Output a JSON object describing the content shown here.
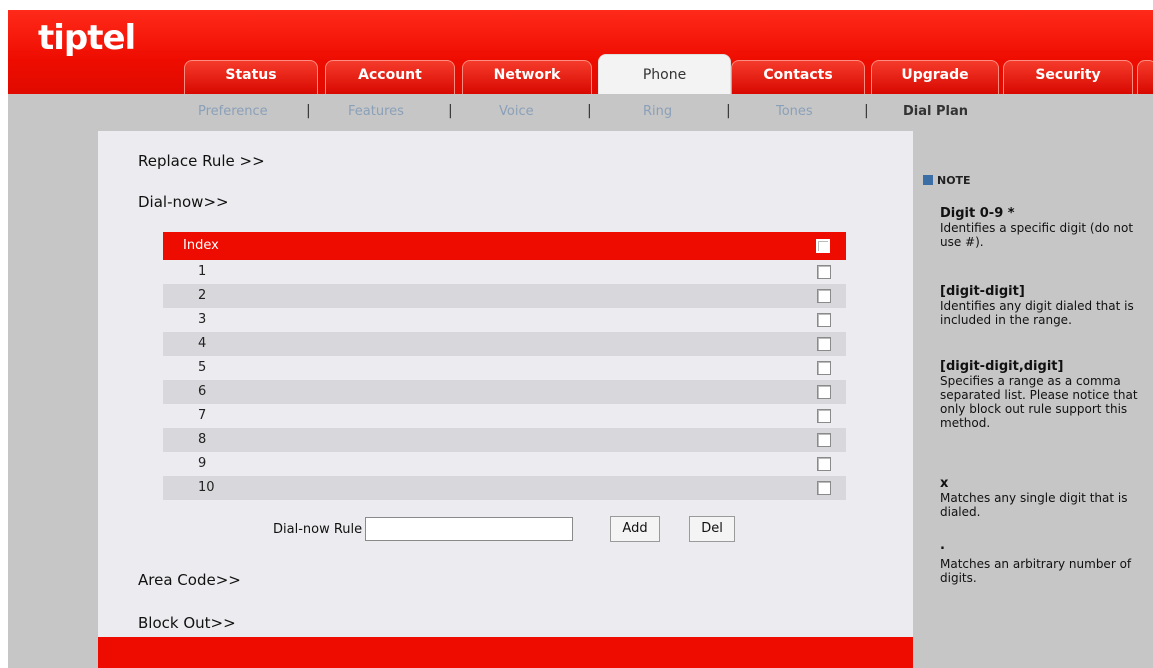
{
  "app": {
    "logo": "tiptel"
  },
  "tabs": [
    {
      "label": "Status"
    },
    {
      "label": "Account"
    },
    {
      "label": "Network"
    },
    {
      "label": "Phone"
    },
    {
      "label": "Contacts"
    },
    {
      "label": "Upgrade"
    },
    {
      "label": "Security"
    }
  ],
  "subnav": [
    {
      "label": "Preference"
    },
    {
      "label": "Features"
    },
    {
      "label": "Voice"
    },
    {
      "label": "Ring"
    },
    {
      "label": "Tones"
    },
    {
      "label": "Dial Plan"
    }
  ],
  "subnav_separator": "|",
  "sections": {
    "replace_rule": "Replace Rule >>",
    "dial_now": "Dial-now>>",
    "area_code": "Area Code>>",
    "block_out": "Block Out>>"
  },
  "table": {
    "header": "Index",
    "rows": [
      "1",
      "2",
      "3",
      "4",
      "5",
      "6",
      "7",
      "8",
      "9",
      "10"
    ]
  },
  "form": {
    "rule_label": "Dial-now Rule",
    "rule_value": "",
    "add_label": "Add",
    "del_label": "Del"
  },
  "note": {
    "heading": "NOTE",
    "items": [
      {
        "title": "Digit 0-9 *",
        "text": "Identifies a specific digit (do not use #)."
      },
      {
        "title": "[digit-digit]",
        "text": "Identifies any digit dialed that is included in the range."
      },
      {
        "title": "[digit-digit,digit]",
        "text": "Specifies a range as a comma separated list. Please notice that only block out rule support this method."
      },
      {
        "title": "x",
        "text": "Matches any single digit that is dialed."
      },
      {
        "title": ".",
        "text": "Matches an arbitrary number of digits."
      }
    ]
  },
  "colors": {
    "accent": "#ee0c00",
    "panel": "#c6c6c6",
    "main_bg": "#ececf0"
  }
}
